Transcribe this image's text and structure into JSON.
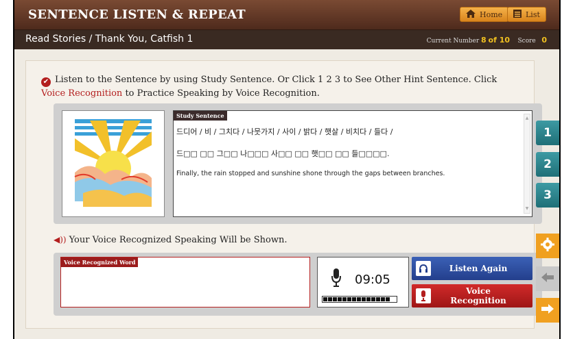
{
  "header": {
    "title": "SENTENCE LISTEN & REPEAT",
    "home_label": "Home",
    "list_label": "List"
  },
  "subbar": {
    "breadcrumb": "Read Stories / Thank You, Catfish 1",
    "current_label": "Current Number",
    "current": "8",
    "of_text": "of 10",
    "score_label": "Score",
    "score": "0"
  },
  "instructions": {
    "part1": "Listen to the Sentence by using Study Sentence. Or Click 1 2 3 to See Other Hint Sentence. Click ",
    "highlight": "Voice Recognition",
    "part2": " to Practice Speaking by Voice Recognition."
  },
  "study": {
    "label": "Study Sentence",
    "words_line": "드디어 / 비 / 그치다 / 나뭇가지 / 사이 / 밝다 / 햇살 / 비치다 / 들다 /",
    "hint_line": "드□□ □□ 그□□ 나□□□ 사□□ □□ 햇□□ □□ 들□□□□.",
    "translation": "Finally, the rain stopped and sunshine shone through the gaps between branches."
  },
  "voice": {
    "heading": "Your Voice Recognized Speaking Will be Shown.",
    "word_label": "Voice Recognized Word",
    "timer": "09:05",
    "meter_level": 1.0,
    "listen_label": "Listen Again",
    "recognition_label": "Voice Recognition"
  },
  "side": {
    "hint1": "1",
    "hint2": "2",
    "hint3": "3"
  },
  "icons": {
    "home": "home-icon",
    "list": "list-icon",
    "check": "check-icon",
    "speaker": "speaker-icon",
    "mic": "microphone-icon",
    "headphones": "headphones-icon",
    "gear": "gear-icon",
    "back": "arrow-left-icon",
    "next": "arrow-right-icon"
  },
  "colors": {
    "header_brown": "#5e3524",
    "accent_red": "#b31e1e",
    "hint_teal": "#2a8189",
    "orange": "#f0a020",
    "listen_blue": "#2d4f9f"
  }
}
